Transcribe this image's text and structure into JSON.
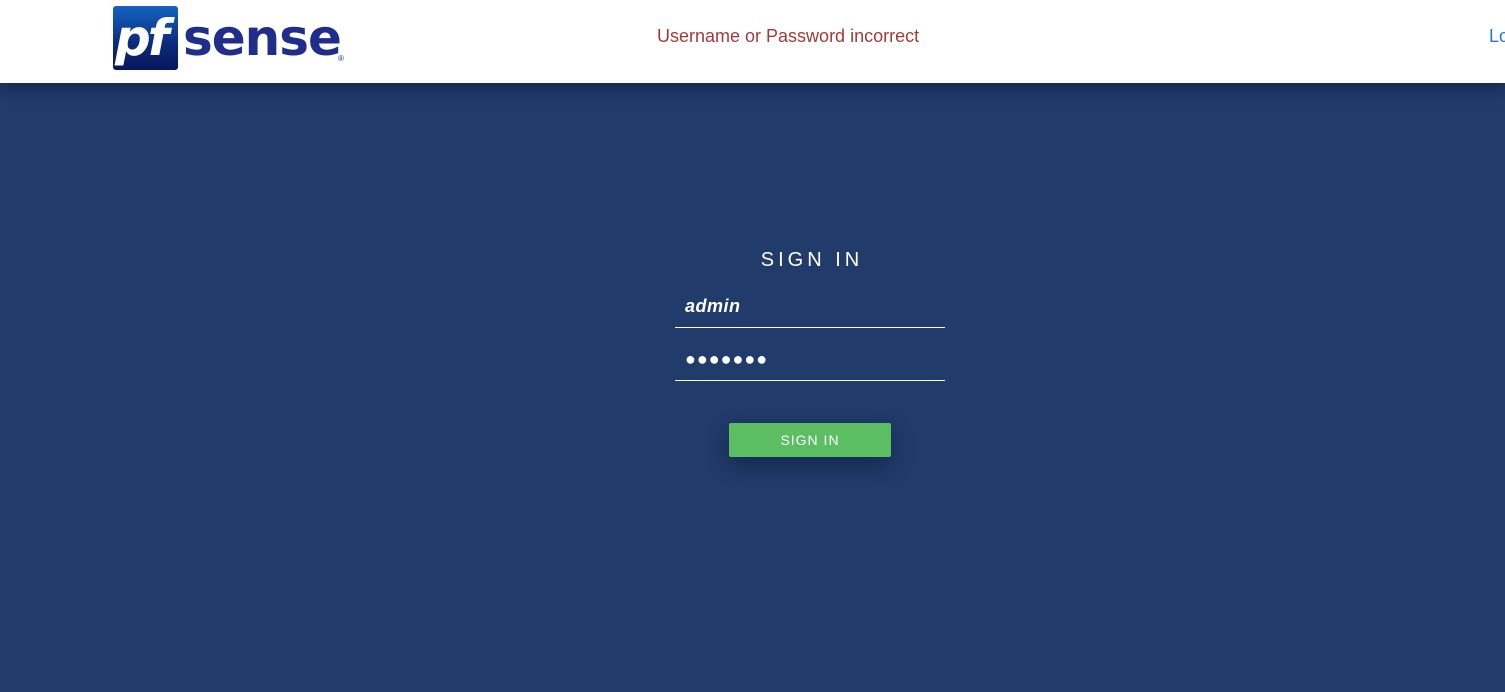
{
  "header": {
    "logo_text_prefix": "pf",
    "logo_text_suffix": "sense",
    "logo_registered": "®",
    "error_message": "Username or Password incorrect",
    "right_link_partial": "Lo"
  },
  "login": {
    "title": "SIGN IN",
    "username_value": "admin",
    "password_value": "●●●●●●●",
    "submit_label": "SIGN IN"
  },
  "colors": {
    "background": "#213b6b",
    "header_bg": "#ffffff",
    "error_text": "#a13a3a",
    "button_green": "#5cbe62",
    "logo_blue": "#212d8a"
  }
}
